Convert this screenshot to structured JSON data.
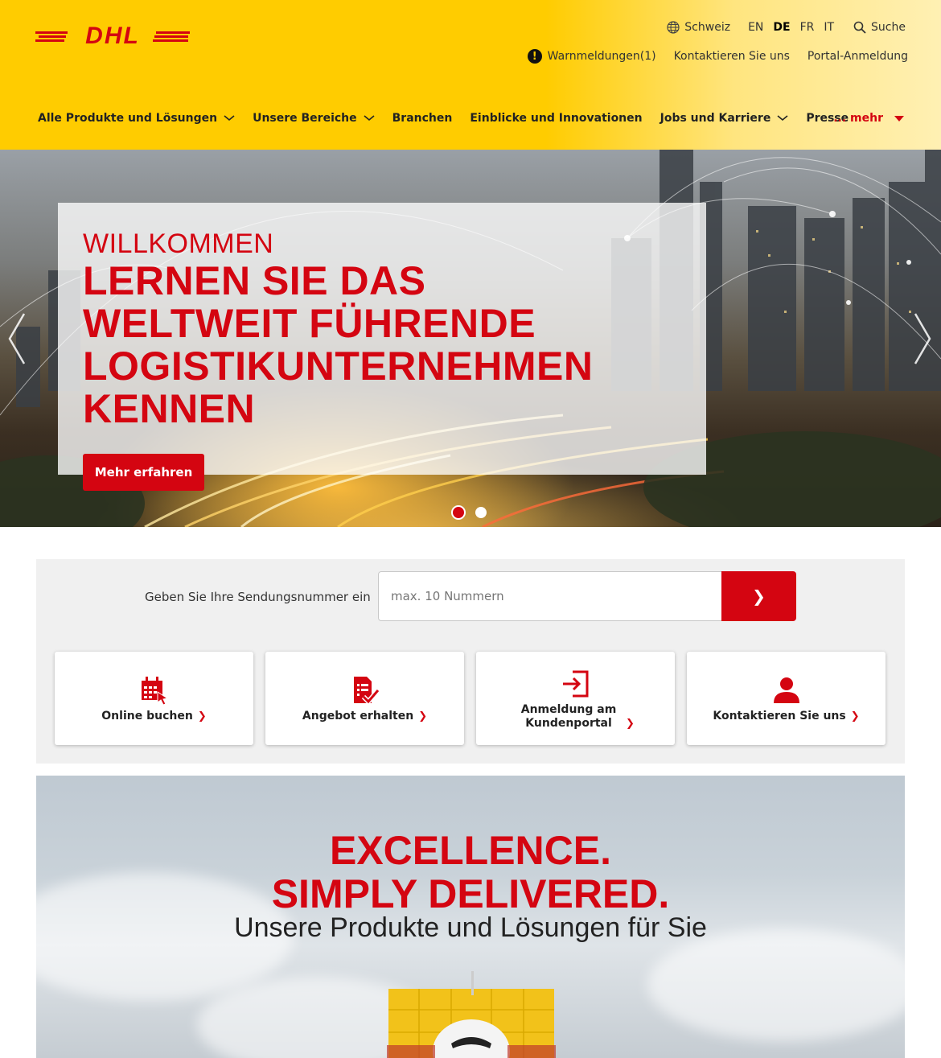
{
  "header": {
    "logo_text": "DHL",
    "country": "Schweiz",
    "languages": [
      "EN",
      "DE",
      "FR",
      "IT"
    ],
    "active_language": "DE",
    "search_label": "Suche",
    "warnings_label": "Warnmeldungen(1)",
    "contact_label": "Kontaktieren Sie uns",
    "portal_label": "Portal-Anmeldung"
  },
  "nav": {
    "items": [
      {
        "label": "Alle Produkte und Lösungen",
        "dropdown": true
      },
      {
        "label": "Unsere Bereiche",
        "dropdown": true
      },
      {
        "label": "Branchen",
        "dropdown": false
      },
      {
        "label": "Einblicke und Innovationen",
        "dropdown": false
      },
      {
        "label": "Jobs und Karriere",
        "dropdown": true
      },
      {
        "label": "Presse",
        "dropdown": false
      }
    ],
    "more_label": "... mehr"
  },
  "hero": {
    "kicker": "WILLKOMMEN",
    "title": "LERNEN SIE DAS WELTWEIT FÜHRENDE LOGISTIKUNTERNEHMEN KENNEN",
    "button_label": "Mehr erfahren",
    "slide_count": 2,
    "active_slide": 1
  },
  "tracking": {
    "label": "Geben Sie Ihre Sendungsnummer ein",
    "placeholder": "max. 10 Nummern",
    "submit_glyph": "❯"
  },
  "quick_links": [
    {
      "label": "Online buchen",
      "icon": "calendar-cursor-icon"
    },
    {
      "label": "Angebot erhalten",
      "icon": "document-check-icon"
    },
    {
      "label": "Anmeldung am Kundenportal",
      "icon": "login-icon"
    },
    {
      "label": "Kontaktieren Sie uns",
      "icon": "person-icon"
    }
  ],
  "banner": {
    "title": "EXCELLENCE. SIMPLY DELIVERED.",
    "subtitle": "Unsere Produkte und Lösungen für Sie"
  },
  "colors": {
    "brand_yellow": "#ffcc00",
    "brand_red": "#d40511"
  }
}
